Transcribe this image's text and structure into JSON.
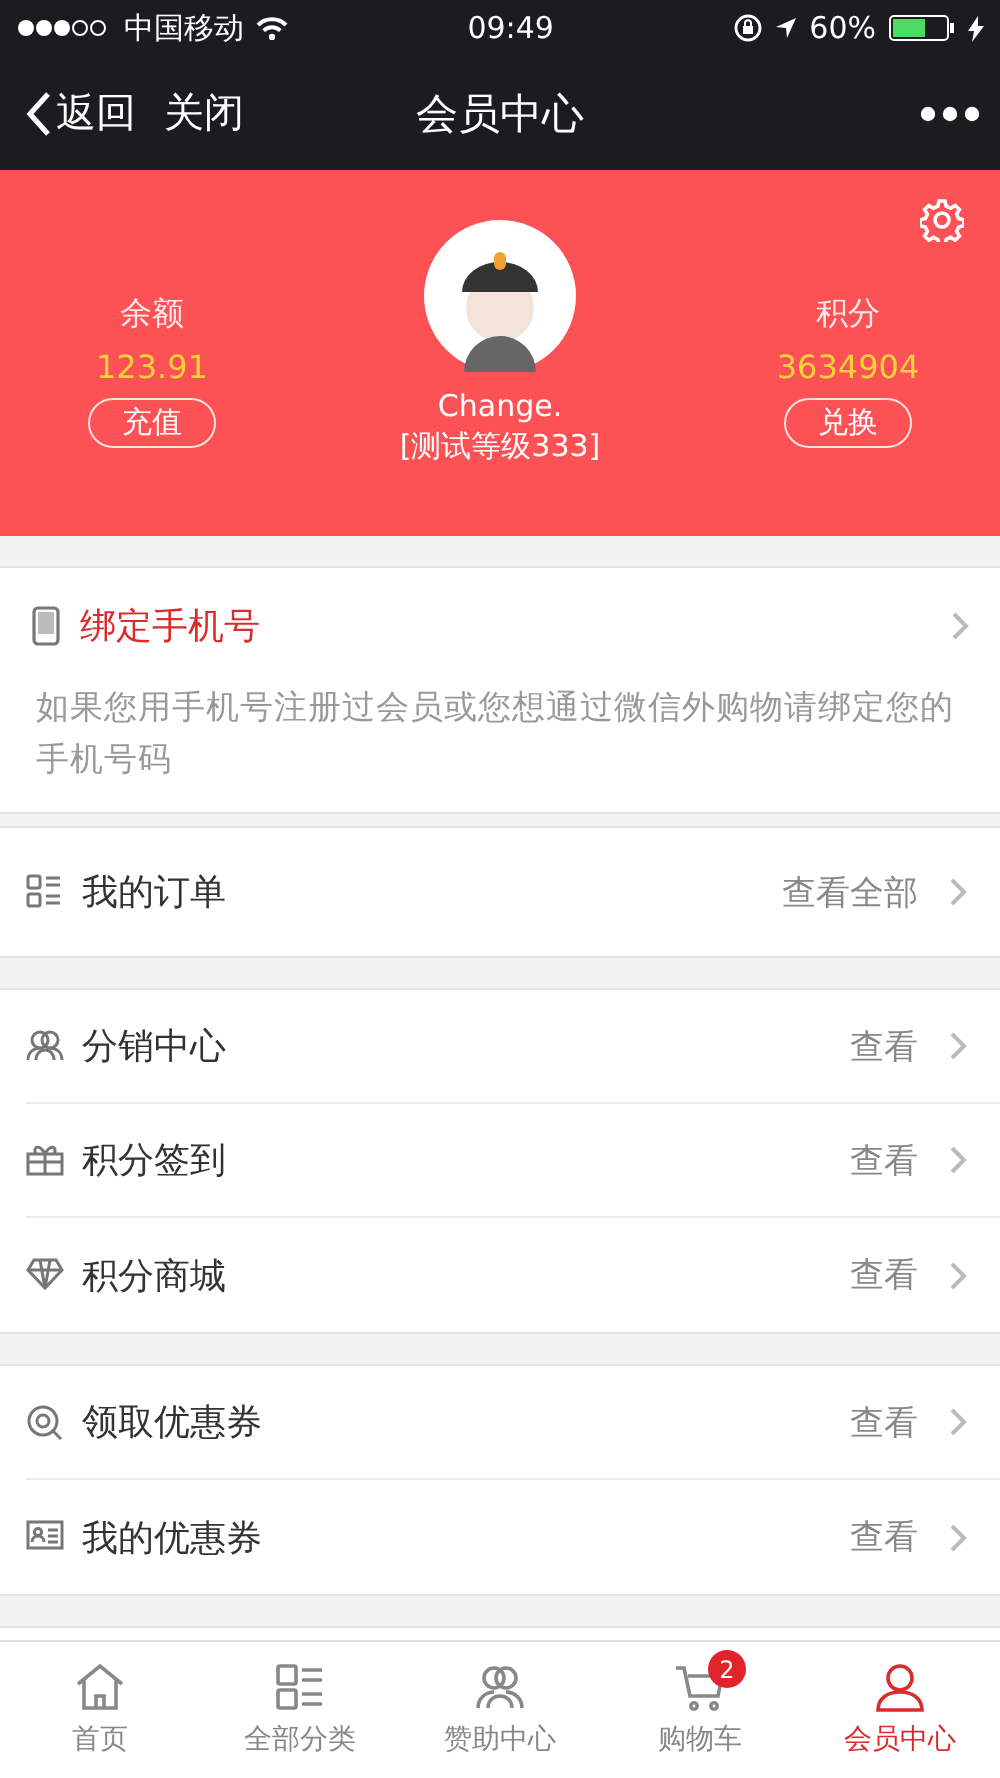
{
  "status_bar": {
    "carrier": "中国移动",
    "time": "09:49",
    "battery": "60%"
  },
  "nav": {
    "back": "返回",
    "close": "关闭",
    "title": "会员中心"
  },
  "profile": {
    "balance_label": "余额",
    "balance": "123.91",
    "recharge": "充值",
    "name": "Change.",
    "level": "[测试等级333]",
    "points_label": "积分",
    "points": "3634904",
    "redeem": "兑换"
  },
  "bind_phone": {
    "title": "绑定手机号",
    "hint": "如果您用手机号注册过会员或您想通过微信外购物请绑定您的手机号码"
  },
  "groups": [
    [
      {
        "kind": "orders",
        "label": "我的订单",
        "action": "查看全部"
      }
    ],
    [
      {
        "kind": "people",
        "label": "分销中心",
        "action": "查看"
      },
      {
        "kind": "gift",
        "label": "积分签到",
        "action": "查看"
      },
      {
        "kind": "diamond",
        "label": "积分商城",
        "action": "查看"
      }
    ],
    [
      {
        "kind": "coupon",
        "label": "领取优惠券",
        "action": "查看"
      },
      {
        "kind": "card",
        "label": "我的优惠券",
        "action": "查看"
      }
    ]
  ],
  "tabs": [
    {
      "kind": "home",
      "label": "首页",
      "selected": false
    },
    {
      "kind": "orders",
      "label": "全部分类",
      "selected": false
    },
    {
      "kind": "people",
      "label": "赞助中心",
      "selected": false
    },
    {
      "kind": "cart",
      "label": "购物车",
      "selected": false,
      "badge": "2"
    },
    {
      "kind": "user",
      "label": "会员中心",
      "selected": true
    }
  ]
}
